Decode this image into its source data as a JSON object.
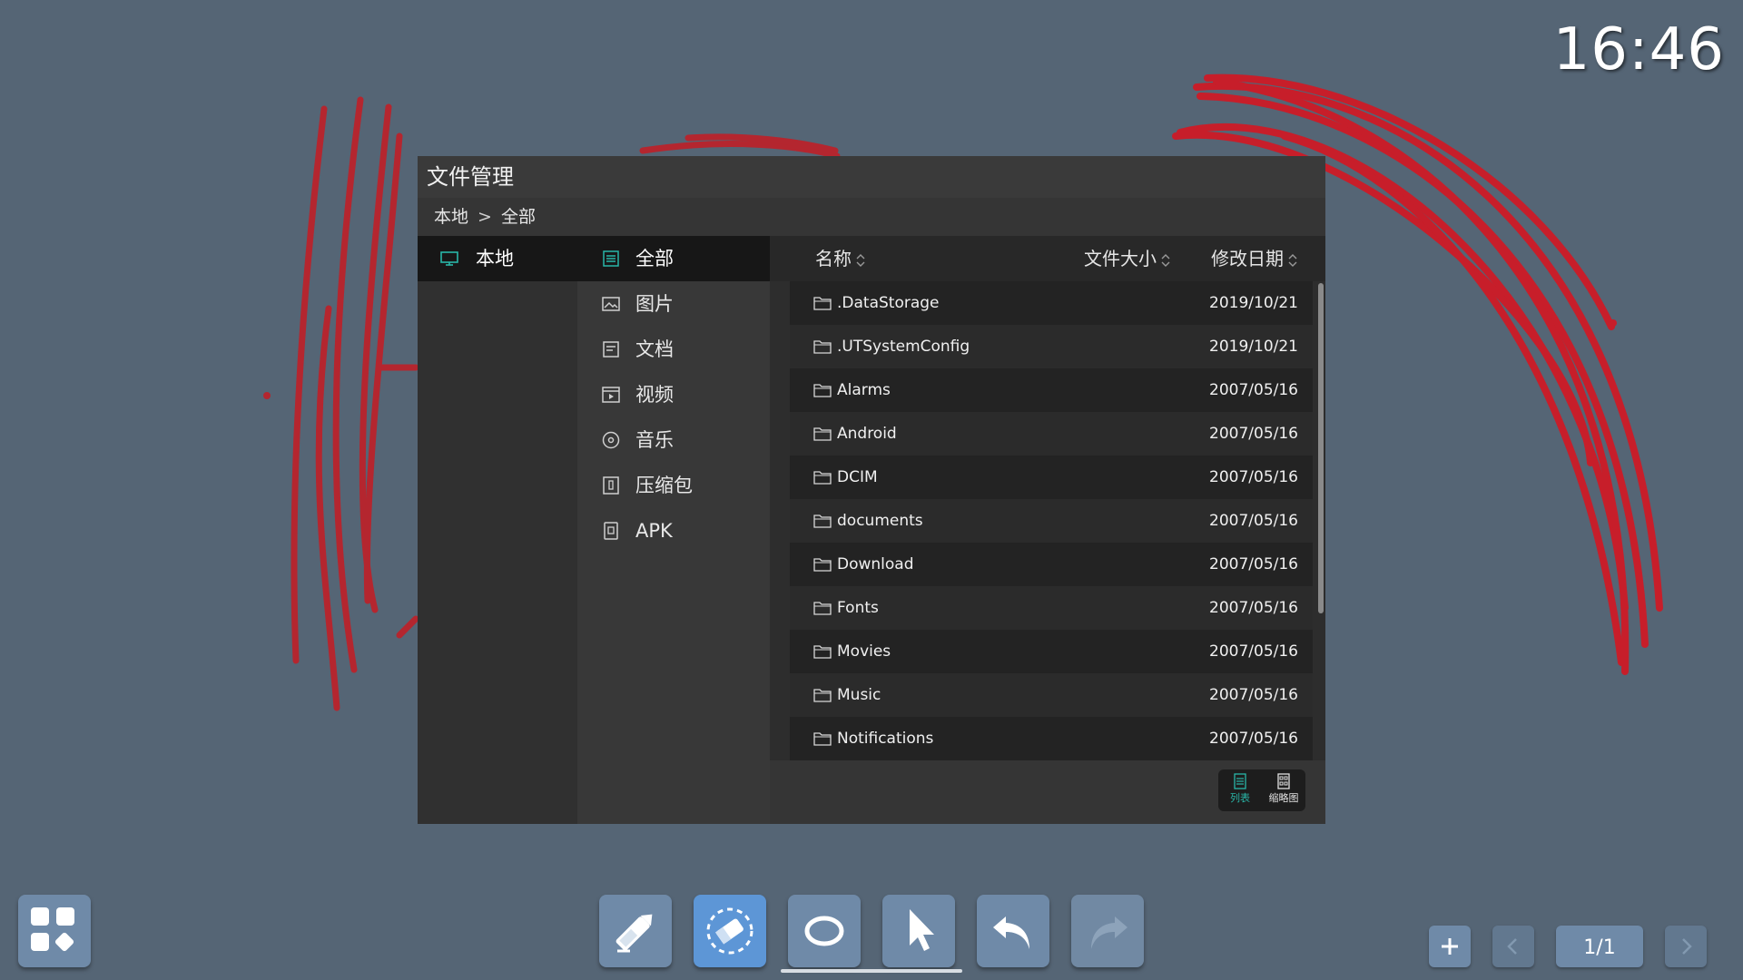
{
  "clock": "16:46",
  "window": {
    "title": "文件管理",
    "breadcrumb": {
      "root": "本地",
      "separator": ">",
      "current": "全部"
    }
  },
  "locations": [
    {
      "label": "本地",
      "icon": "monitor-icon",
      "active": true
    }
  ],
  "categories": [
    {
      "label": "全部",
      "icon": "all-files-icon",
      "active": true
    },
    {
      "label": "图片",
      "icon": "image-icon",
      "active": false
    },
    {
      "label": "文档",
      "icon": "document-icon",
      "active": false
    },
    {
      "label": "视频",
      "icon": "video-icon",
      "active": false
    },
    {
      "label": "音乐",
      "icon": "music-icon",
      "active": false
    },
    {
      "label": "压缩包",
      "icon": "archive-icon",
      "active": false
    },
    {
      "label": "APK",
      "icon": "apk-icon",
      "active": false
    }
  ],
  "columns": {
    "name": "名称",
    "size": "文件大小",
    "date": "修改日期"
  },
  "files": [
    {
      "name": ".DataStorage",
      "date": "2019/10/21"
    },
    {
      "name": ".UTSystemConfig",
      "date": "2019/10/21"
    },
    {
      "name": "Alarms",
      "date": "2007/05/16"
    },
    {
      "name": "Android",
      "date": "2007/05/16"
    },
    {
      "name": "DCIM",
      "date": "2007/05/16"
    },
    {
      "name": "documents",
      "date": "2007/05/16"
    },
    {
      "name": "Download",
      "date": "2007/05/16"
    },
    {
      "name": "Fonts",
      "date": "2007/05/16"
    },
    {
      "name": "Movies",
      "date": "2007/05/16"
    },
    {
      "name": "Music",
      "date": "2007/05/16"
    },
    {
      "name": "Notifications",
      "date": "2007/05/16"
    }
  ],
  "view_modes": {
    "list": "列表",
    "thumbnail": "缩略图",
    "active": "list"
  },
  "toolbar": {
    "tools": [
      "pen-icon",
      "eraser-icon",
      "shape-icon",
      "select-icon",
      "undo-icon",
      "redo-icon"
    ],
    "active_tool": "eraser-icon"
  },
  "pager": {
    "indicator": "1/1"
  },
  "colors": {
    "background": "#556575",
    "accent": "#29b6a8",
    "ink": "#c8102e",
    "dock_button": "#6f8aa8"
  }
}
